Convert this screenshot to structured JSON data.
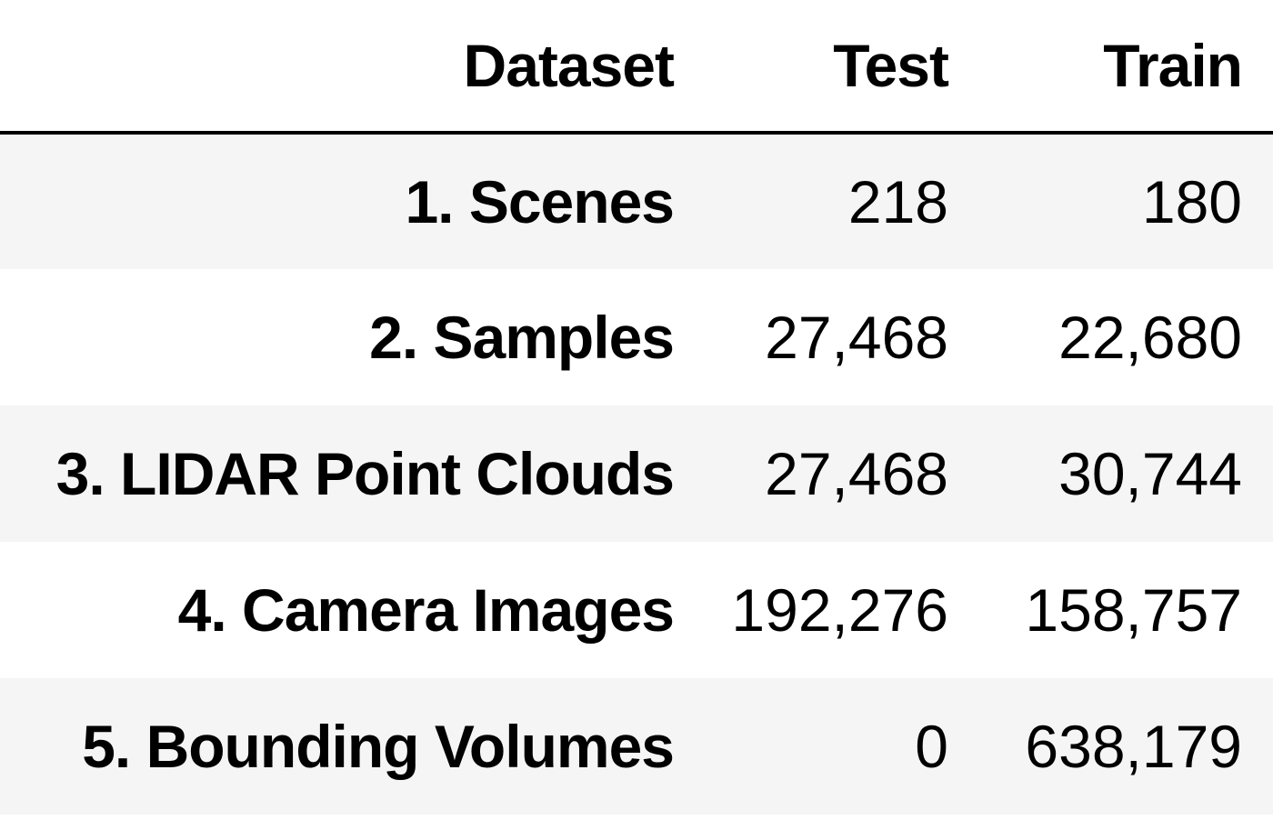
{
  "table": {
    "columns": [
      "Dataset",
      "Test",
      "Train"
    ],
    "rows": [
      {
        "name": "1. Scenes",
        "test": "218",
        "train": "180"
      },
      {
        "name": "2. Samples",
        "test": "27,468",
        "train": "22,680"
      },
      {
        "name": "3. LIDAR Point Clouds",
        "test": "27,468",
        "train": "30,744"
      },
      {
        "name": "4. Camera Images",
        "test": "192,276",
        "train": "158,757"
      },
      {
        "name": "5. Bounding Volumes",
        "test": "0",
        "train": "638,179"
      }
    ]
  },
  "colors": {
    "text": "#000000",
    "stripe": "#f5f5f5",
    "background": "#ffffff",
    "header_rule": "#000000"
  }
}
